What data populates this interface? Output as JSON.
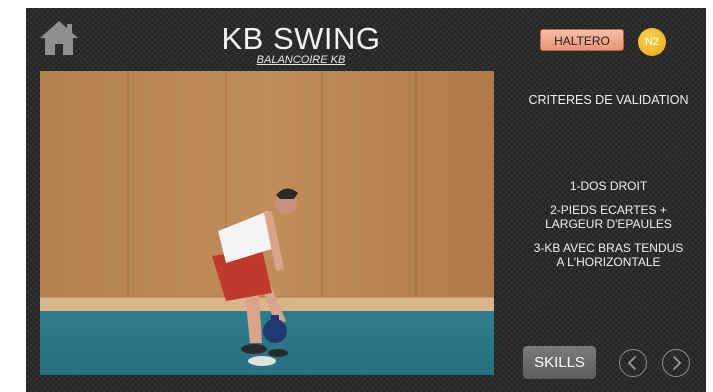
{
  "header": {
    "home_icon": "home-icon",
    "title": "KB SWING",
    "subtitle": "BALANCOIRE KB",
    "category_badge": "HALTERO",
    "level_badge": "N2"
  },
  "colors": {
    "background": "#2b2b2b",
    "category_badge": "#f0a98d",
    "level_badge": "#f2b92e",
    "skills_button": "#6b6b6b"
  },
  "video": {
    "icon": "video-frame"
  },
  "criteria": {
    "heading": "CRITERES DE VALIDATION",
    "items": [
      [
        "1-DOS DROIT"
      ],
      [
        "2-PIEDS ECARTES +",
        "LARGEUR D'EPAULES"
      ],
      [
        "3-KB AVEC BRAS TENDUS",
        "A L'HORIZONTALE"
      ]
    ]
  },
  "footer": {
    "skills_label": "SKILLS",
    "prev_icon": "chevron-left-icon",
    "next_icon": "chevron-right-icon"
  }
}
